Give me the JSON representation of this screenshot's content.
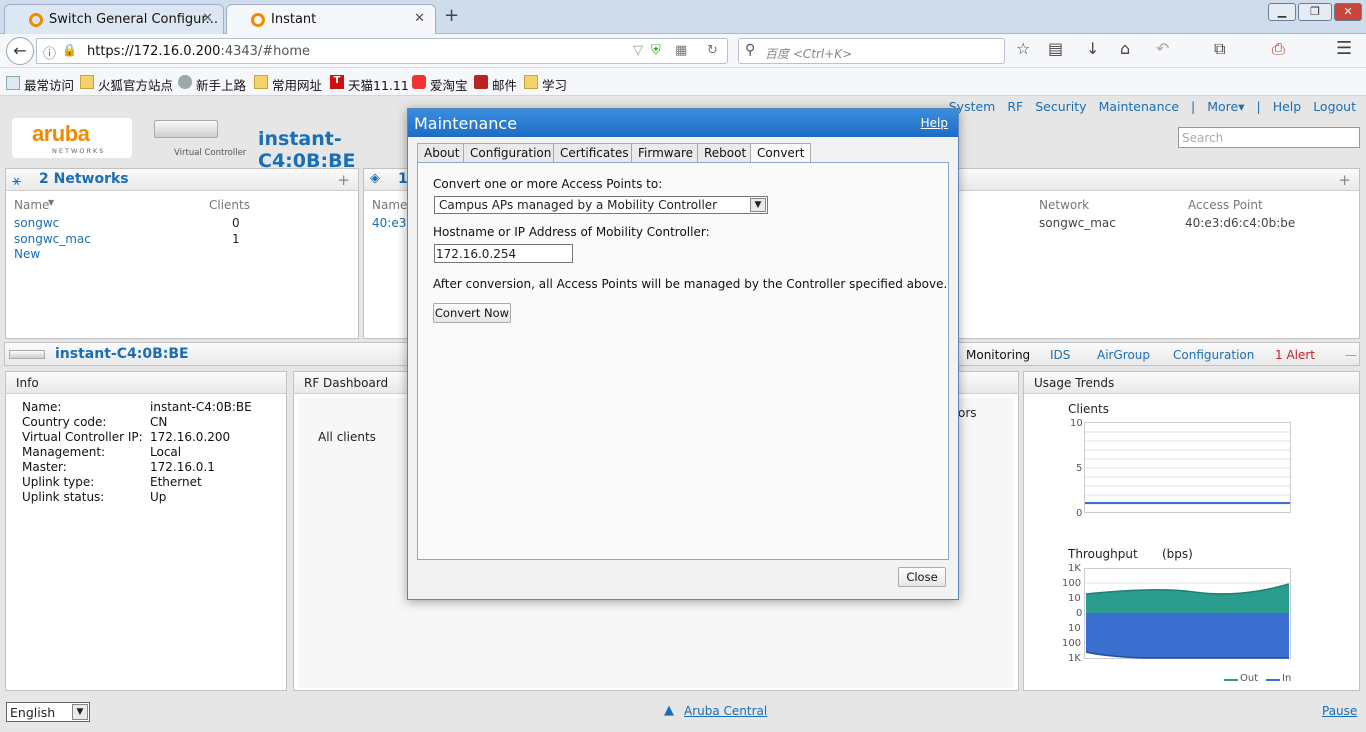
{
  "browser": {
    "tabs": [
      {
        "title": "Switch General Configur..."
      },
      {
        "title": "Instant"
      }
    ],
    "url_host": "https://172.16.0.200",
    "url_rest": ":4343/#home",
    "search_placeholder": "百度 <Ctrl+K>",
    "bookmarks": [
      "最常访问",
      "火狐官方站点",
      "新手上路",
      "常用网址",
      "天猫11.11",
      "爱淘宝",
      "邮件",
      "学习"
    ]
  },
  "topnav": {
    "items": [
      "System",
      "RF",
      "Security",
      "Maintenance",
      "|",
      "More▾",
      "|",
      "Help",
      "Logout"
    ],
    "search_placeholder": "Search"
  },
  "header": {
    "logo_text": "aruba",
    "logo_sub": "NETWORKS",
    "vc_label": "Virtual Controller",
    "vc_title": "instant-C4:0B:BE"
  },
  "networks": {
    "title": "2 Networks",
    "col_name": "Name",
    "col_clients": "Clients",
    "rows": [
      {
        "name": "songwc",
        "clients": "0"
      },
      {
        "name": "songwc_mac",
        "clients": "1"
      }
    ],
    "new_label": "New"
  },
  "aps": {
    "title": "1",
    "col_name": "Name",
    "row_name": "40:e3"
  },
  "clients_panel": {
    "col_network": "Network",
    "col_ap": "Access Point",
    "row_network": "songwc_mac",
    "row_ap": "40:e3:d6:c4:0b:be"
  },
  "vc_bar": {
    "name": "instant-C4:0B:BE",
    "tabs": [
      "Monitoring",
      "IDS",
      "AirGroup",
      "Configuration"
    ],
    "alert": "1 Alert"
  },
  "info": {
    "title": "Info",
    "rows": [
      {
        "k": "Name:",
        "v": "instant-C4:0B:BE"
      },
      {
        "k": "Country code:",
        "v": "CN"
      },
      {
        "k": "Virtual Controller IP:",
        "v": "172.16.0.200"
      },
      {
        "k": "Management:",
        "v": "Local"
      },
      {
        "k": "Master:",
        "v": "172.16.0.1"
      },
      {
        "k": "Uplink type:",
        "v": "Ethernet"
      },
      {
        "k": "Uplink status:",
        "v": "Up"
      }
    ]
  },
  "rf_dashboard": {
    "title": "RF Dashboard",
    "all_clients": "All clients",
    "partial_label": "ors"
  },
  "usage": {
    "title": "Usage Trends",
    "clients_label": "Clients",
    "clients_ticks": [
      "10",
      "5",
      "0"
    ],
    "throughput_label": "Throughput",
    "throughput_unit": "(bps)",
    "throughput_ticks": [
      "1K",
      "100",
      "10",
      "0",
      "10",
      "100",
      "1K"
    ],
    "legend_out": "Out",
    "legend_in": "In",
    "color_out": "#2a9d8f",
    "color_in": "#3a6fd0"
  },
  "modal": {
    "title": "Maintenance",
    "help": "Help",
    "tabs": [
      "About",
      "Configuration",
      "Certificates",
      "Firmware",
      "Reboot",
      "Convert"
    ],
    "active_tab": "Convert",
    "convert_label": "Convert one or more Access Points to:",
    "convert_option": "Campus APs managed by a Mobility Controller",
    "host_label": "Hostname or IP Address of Mobility Controller:",
    "host_value": "172.16.0.254",
    "after_text": "After conversion, all Access Points will be managed by the Controller specified above.",
    "convert_button": "Convert Now",
    "close_button": "Close"
  },
  "footer": {
    "language": "English",
    "central_link": "Aruba Central",
    "pause": "Pause"
  }
}
